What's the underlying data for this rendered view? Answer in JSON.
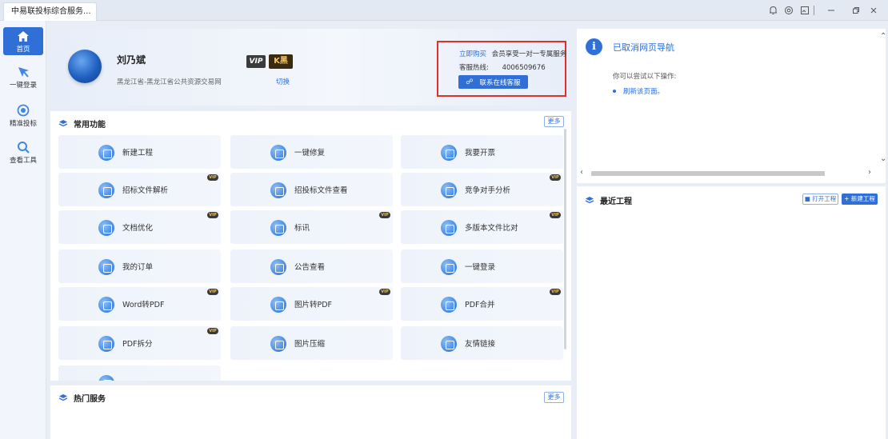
{
  "tab": {
    "title": "中易联投标综合服务..."
  },
  "sidebar": {
    "items": [
      {
        "label": "首页",
        "icon": "home-icon",
        "active": true
      },
      {
        "label": "一键登录",
        "icon": "login-icon",
        "active": false
      },
      {
        "label": "精准投标",
        "icon": "target-icon",
        "active": false
      },
      {
        "label": "查看工具",
        "icon": "search-icon",
        "active": false
      }
    ]
  },
  "profile": {
    "name": "刘乃斌",
    "org": "黑龙江省-黑龙江省公共资源交易网",
    "vip_badge": "VIP",
    "ks_badge": "K黑",
    "switch_label": "切换",
    "buy_link": "立即购买",
    "buy_desc": "会员享受一对一专属服务",
    "hotline_label": "客服热线:",
    "hotline_number": "4006509676",
    "contact_button": "联系在线客服"
  },
  "functions": {
    "title": "常用功能",
    "more_label": "更多",
    "tiles": [
      {
        "label": "新建工程",
        "vip": false
      },
      {
        "label": "一键修复",
        "vip": false
      },
      {
        "label": "我要开票",
        "vip": false
      },
      {
        "label": "招标文件解析",
        "vip": true
      },
      {
        "label": "招投标文件查看",
        "vip": false
      },
      {
        "label": "竞争对手分析",
        "vip": true
      },
      {
        "label": "文档优化",
        "vip": true
      },
      {
        "label": "标讯",
        "vip": true
      },
      {
        "label": "多版本文件比对",
        "vip": true
      },
      {
        "label": "我的订单",
        "vip": false
      },
      {
        "label": "公告查看",
        "vip": false
      },
      {
        "label": "一键登录",
        "vip": false
      },
      {
        "label": "Word转PDF",
        "vip": true
      },
      {
        "label": "图片转PDF",
        "vip": true
      },
      {
        "label": "PDF合并",
        "vip": true
      },
      {
        "label": "PDF拆分",
        "vip": true
      },
      {
        "label": "图片压缩",
        "vip": false
      },
      {
        "label": "友情链接",
        "vip": false
      }
    ],
    "vip_tag": "VIP"
  },
  "hot": {
    "title": "热门服务",
    "more_label": "更多"
  },
  "nav_error": {
    "title": "已取消网页导航",
    "hint": "你可以尝试以下操作:",
    "refresh": "刷新该页面。"
  },
  "recent": {
    "title": "最近工程",
    "open_label": "打开工程",
    "new_label": "+ 新建工程"
  },
  "colors": {
    "accent": "#2f6fd6",
    "highlight_border": "#e0302c"
  }
}
